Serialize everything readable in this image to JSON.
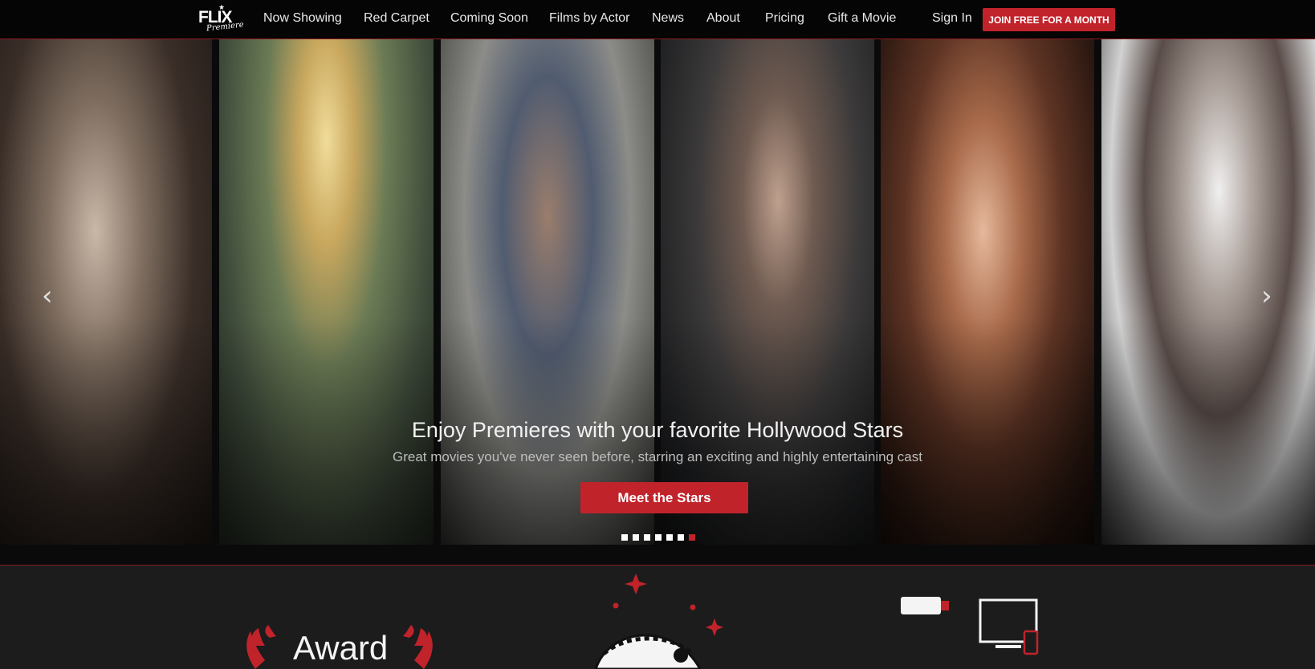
{
  "logo": {
    "name": "FLIX",
    "tagline": "Premiere"
  },
  "nav": {
    "items": [
      "Now Showing",
      "Red Carpet",
      "Coming Soon",
      "Films by Actor",
      "News",
      "About",
      "Pricing",
      "Gift a Movie"
    ],
    "sign_in": "Sign In",
    "join": "JOIN FREE FOR A MONTH"
  },
  "hero": {
    "title": "Enjoy Premieres with your favorite Hollywood Stars",
    "subtitle": "Great movies you've never seen before, starring an exciting and highly entertaining cast",
    "cta": "Meet the Stars",
    "prev_arrow": "‹",
    "next_arrow": "›",
    "slide_count": 7,
    "active_slide": 7
  },
  "features": {
    "award_heading": "Award"
  },
  "colors": {
    "accent": "#c1232b",
    "topbar": "#050505",
    "background": "#1c1c1c"
  }
}
